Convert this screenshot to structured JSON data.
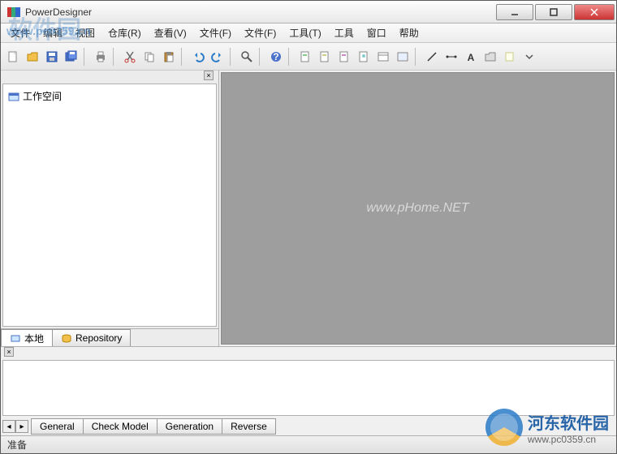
{
  "window": {
    "title": "PowerDesigner"
  },
  "menu": {
    "items": [
      "文件",
      "编辑",
      "视图",
      "仓库(R)",
      "查看(V)",
      "文件(F)",
      "文件(F)",
      "工具(T)",
      "工具",
      "窗口",
      "帮助"
    ]
  },
  "toolbar": {
    "groups": [
      [
        "new",
        "open",
        "save",
        "saveall"
      ],
      [
        "print"
      ],
      [
        "cut",
        "copy",
        "paste"
      ],
      [
        "undo",
        "redo"
      ],
      [
        "find"
      ],
      [
        "help"
      ],
      [
        "model1",
        "model2",
        "model3",
        "model4",
        "model5",
        "model6"
      ],
      [
        "line",
        "rect",
        "text",
        "folder",
        "folder2",
        "arrow"
      ]
    ]
  },
  "browser": {
    "root": "工作空间",
    "tabs": [
      {
        "key": "local",
        "label": "本地"
      },
      {
        "key": "repo",
        "label": "Repository"
      }
    ]
  },
  "canvas": {
    "watermark": "www.pHome.NET"
  },
  "output": {
    "tabs": [
      "General",
      "Check Model",
      "Generation",
      "Reverse"
    ]
  },
  "status": {
    "text": "准备"
  },
  "overlay": {
    "top_text": "www.pc0359.cn",
    "br_line1": "河东软件园",
    "br_line2": "www.pc0359.cn"
  },
  "colors": {
    "canvas_bg": "#9e9e9e"
  }
}
